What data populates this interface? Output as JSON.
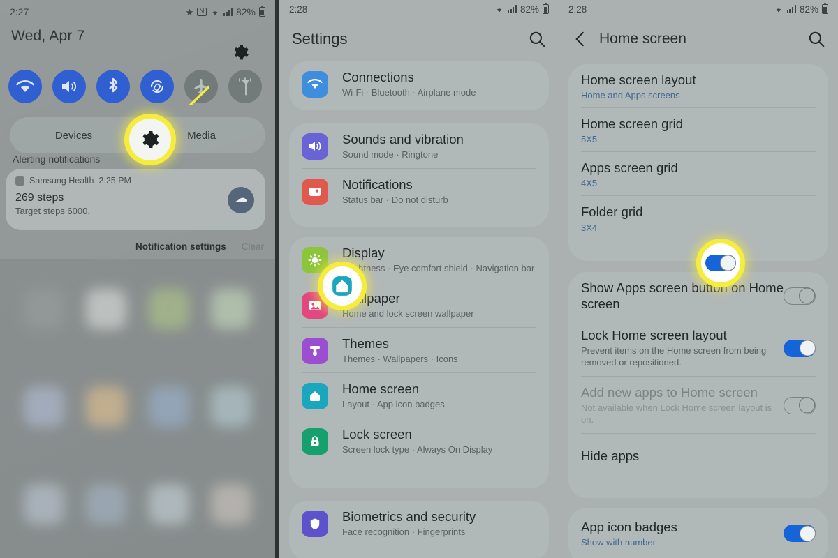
{
  "panel1": {
    "name": "quick-settings-panel",
    "status_bar": {
      "time": "2:27",
      "battery_percent": "82%",
      "icons": [
        "bluetooth-icon",
        "nfc-icon",
        "wifi-icon",
        "signal-icon",
        "battery-icon"
      ]
    },
    "date": "Wed, Apr 7",
    "gear_icon": "gear-icon",
    "quick_toggles": [
      {
        "name": "wifi-toggle",
        "icon": "wifi-icon",
        "active": true
      },
      {
        "name": "sound-toggle",
        "icon": "speaker-icon",
        "active": true
      },
      {
        "name": "bluetooth-toggle",
        "icon": "bluetooth-icon",
        "active": true
      },
      {
        "name": "auto-rotate-toggle",
        "icon": "rotate-icon",
        "active": true
      },
      {
        "name": "airplane-mode-toggle",
        "icon": "airplane-icon",
        "active": false
      },
      {
        "name": "flashlight-toggle",
        "icon": "flashlight-icon",
        "active": false
      }
    ],
    "media_bar": {
      "devices_label": "Devices",
      "media_label": "Media"
    },
    "alerting_label": "Alerting notifications",
    "notification": {
      "app_name": "Samsung Health",
      "time": "2:25 PM",
      "title": "269 steps",
      "subtitle": "Target steps 6000.",
      "icon": "shoe-icon"
    },
    "actions": {
      "settings": "Notification settings",
      "clear": "Clear"
    },
    "callout": {
      "icon": "gear-icon"
    }
  },
  "panel2": {
    "name": "settings-list-panel",
    "status_bar": {
      "time": "2:28",
      "battery_percent": "82%"
    },
    "header": {
      "title": "Settings",
      "search_icon": "search-icon"
    },
    "items": [
      {
        "title": "Connections",
        "subtitle": "Wi-Fi  ·  Bluetooth  ·  Airplane mode",
        "icon": "wifi-icon",
        "color": "#3f8ede"
      },
      {
        "title": "Sounds and vibration",
        "subtitle": "Sound mode  ·  Ringtone",
        "icon": "speaker-icon",
        "color": "#6a63d6"
      },
      {
        "title": "Notifications",
        "subtitle": "Status bar  ·  Do not disturb",
        "icon": "notification-icon",
        "color": "#e1584f"
      },
      {
        "title": "Display",
        "subtitle": "Brightness  ·  Eye comfort shield  ·  Navigation bar",
        "icon": "brightness-icon",
        "color": "#8cc43c"
      },
      {
        "title": "Wallpaper",
        "subtitle": "Home and lock screen wallpaper",
        "icon": "image-icon",
        "color": "#e0487f"
      },
      {
        "title": "Themes",
        "subtitle": "Themes  ·  Wallpapers  ·  Icons",
        "icon": "paintbrush-icon",
        "color": "#9b4fd0"
      },
      {
        "title": "Home screen",
        "subtitle": "Layout  ·  App icon badges",
        "icon": "home-icon",
        "color": "#1aa6bd"
      },
      {
        "title": "Lock screen",
        "subtitle": "Screen lock type  ·  Always On Display",
        "icon": "lock-icon",
        "color": "#15a06e"
      },
      {
        "title": "Biometrics and security",
        "subtitle": "Face recognition  ·  Fingerprints",
        "icon": "shield-icon",
        "color": "#5b52cc"
      }
    ],
    "callout": {
      "icon": "home-icon"
    }
  },
  "panel3": {
    "name": "home-screen-settings-panel",
    "status_bar": {
      "time": "2:28",
      "battery_percent": "82%"
    },
    "header": {
      "back_icon": "back-arrow-icon",
      "title": "Home screen",
      "search_icon": "search-icon"
    },
    "items": [
      {
        "title": "Home screen layout",
        "value": "Home and Apps screens",
        "type": "value"
      },
      {
        "title": "Home screen grid",
        "value": "5X5",
        "type": "value"
      },
      {
        "title": "Apps screen grid",
        "value": "4X5",
        "type": "value"
      },
      {
        "title": "Folder grid",
        "value": "3X4",
        "type": "value"
      },
      {
        "title": "Show Apps screen button on Home screen",
        "value": "",
        "type": "toggle",
        "toggle_on": false,
        "dim": false
      },
      {
        "title": "Lock Home screen layout",
        "value": "Prevent items on the Home screen from being removed or repositioned.",
        "type": "toggle",
        "toggle_on": true,
        "dim": false
      },
      {
        "title": "Add new apps to Home screen",
        "value": "Not available when Lock Home screen layout is on.",
        "type": "toggle",
        "toggle_on": false,
        "dim": true
      },
      {
        "title": "Hide apps",
        "value": "",
        "type": "plain"
      },
      {
        "title": "App icon badges",
        "value": "Show with number",
        "type": "toggle-sep",
        "toggle_on": true,
        "dim": false
      }
    ],
    "callout": {
      "toggle_on": true
    }
  },
  "colors": {
    "accent_blue": "#1565d8",
    "highlight_yellow": "#f5ec3d",
    "quick_toggle_blue": "#2f5fd0",
    "link_blue": "#41698f"
  }
}
